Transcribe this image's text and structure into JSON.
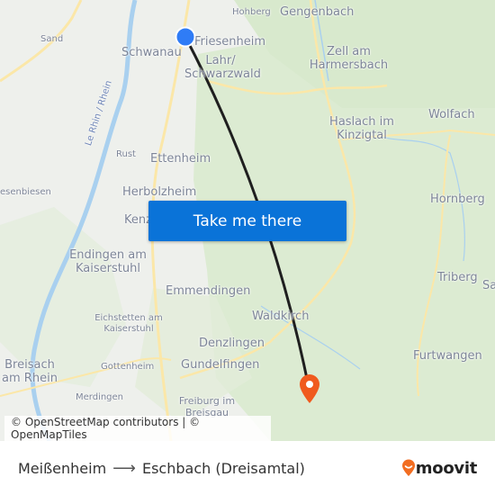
{
  "map": {
    "labels": {
      "hohberg": "Hohberg",
      "gengenbach": "Gengenbach",
      "sand": "Sand",
      "schwanau": "Schwanau",
      "friesenheim": "Friesenheim",
      "lahr1": "Lahr/",
      "lahr2": "Schwarzwald",
      "zell1": "Zell am",
      "zell2": "Harmersbach",
      "haslach1": "Haslach im",
      "haslach2": "Kinzigtal",
      "wolfach": "Wolfach",
      "rhein": "Le Rhin / Rhein",
      "rust": "Rust",
      "ettenheim": "Ettenheim",
      "wiesenbiesen": "esenbiesen",
      "herbolzheim": "Herbolzheim",
      "kenzingen": "Kenz",
      "hornberg": "Hornberg",
      "endingen1": "Endingen am",
      "endingen2": "Kaiserstuhl",
      "triberg": "Triberg",
      "sa": "Sa",
      "emmendingen": "Emmendingen",
      "waldkirch": "Waldkirch",
      "eichstetten1": "Eichstetten am",
      "eichstetten2": "Kaiserstuhl",
      "denzlingen": "Denzlingen",
      "breisach1": "Breisach",
      "breisach2": "am Rhein",
      "gottenheim": "Gottenheim",
      "gundelfingen": "Gundelfingen",
      "furtwangen": "Furtwangen",
      "merdingen": "Merdingen",
      "freiburg1": "Freiburg im",
      "freiburg2": "Breisgau"
    },
    "origin_marker": {
      "icon": "origin-dot-icon",
      "color": "#2f7cf6"
    },
    "destination_marker": {
      "icon": "destination-pin-icon",
      "color": "#f05a1e"
    },
    "route_line_color": "#1f1f1f"
  },
  "cta": {
    "label": "Take me there",
    "color": "#0a73d8"
  },
  "attribution": {
    "text": "© OpenStreetMap contributors | © OpenMapTiles"
  },
  "footer": {
    "origin": "Meißenheim",
    "arrow_icon": "arrow-right-icon",
    "arrow": "⟶",
    "destination": "Eschbach (Dreisamtal)",
    "logo": {
      "text": "moovit",
      "icon": "moovit-pin-icon",
      "color": "#f26d21"
    }
  }
}
